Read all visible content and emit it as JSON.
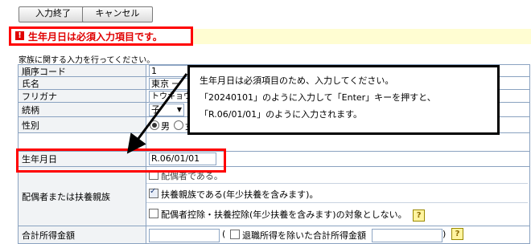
{
  "toolbar": {
    "finish_label": "入力終了",
    "cancel_label": "キャンセル"
  },
  "error": {
    "icon": "!",
    "message": "生年月日は必須入力項目です。"
  },
  "instruction": "家族に関する入力を行ってください。",
  "rows": {
    "order_code": {
      "label": "順序コード",
      "value": "1"
    },
    "name": {
      "label": "氏名",
      "value": "東京 一"
    },
    "kana": {
      "label": "フリガナ",
      "value": "トウキョウ イ"
    },
    "relation": {
      "label": "続柄",
      "value": "子"
    },
    "gender": {
      "label": "性別",
      "opt_male": "男",
      "opt_female": "女"
    },
    "birthdate": {
      "label": "生年月日",
      "value": "R.06/01/01"
    },
    "dependency": {
      "label": "配偶者または扶養親族",
      "opt_spouse": "配偶者である。",
      "opt_dependent": "扶養親族である(年少扶養を含みます)。",
      "opt_exclude": "配偶者控除・扶養控除(年少扶養を含みます)の対象としない。"
    },
    "income": {
      "label": "合計所得金額",
      "open_paren": "(",
      "retire_label": "退職所得を除いた合計所得金額",
      "close_paren": ")"
    }
  },
  "callout": {
    "line1": "生年月日は必須項目のため、入力してください。",
    "line2": "「20240101」のように入力して「Enter」キーを押すと、",
    "line3": "「R.06/01/01」のように入力されます。"
  },
  "help_icon": "?"
}
